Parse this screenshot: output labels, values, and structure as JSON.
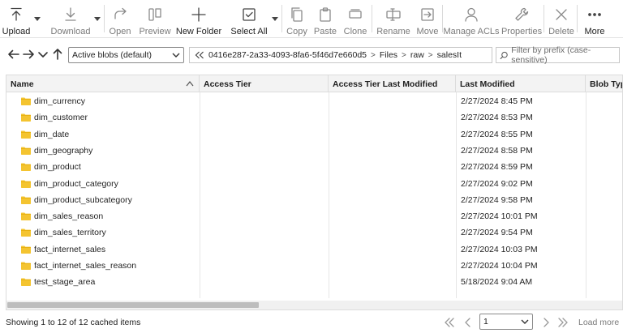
{
  "toolbar": {
    "upload": "Upload",
    "download": "Download",
    "open": "Open",
    "preview": "Preview",
    "new_folder": "New Folder",
    "select_all": "Select All",
    "copy": "Copy",
    "paste": "Paste",
    "clone": "Clone",
    "rename": "Rename",
    "move": "Move",
    "manage_acls": "Manage ACLs",
    "properties": "Properties",
    "delete": "Delete",
    "more": "More"
  },
  "nav": {
    "blob_filter": "Active blobs (default)",
    "breadcrumb": [
      "0416e287-2a33-4093-8fa6-5f46d7e660d5",
      "Files",
      "raw",
      "salesIt"
    ],
    "filter_placeholder": "Filter by prefix (case-sensitive)"
  },
  "grid": {
    "columns": [
      "Name",
      "Access Tier",
      "Access Tier Last Modified",
      "Last Modified",
      "Blob Type"
    ],
    "rows": [
      {
        "name": "dim_currency",
        "modified": "2/27/2024 8:45 PM"
      },
      {
        "name": "dim_customer",
        "modified": "2/27/2024 8:53 PM"
      },
      {
        "name": "dim_date",
        "modified": "2/27/2024 8:55 PM"
      },
      {
        "name": "dim_geography",
        "modified": "2/27/2024 8:58 PM"
      },
      {
        "name": "dim_product",
        "modified": "2/27/2024 8:59 PM"
      },
      {
        "name": "dim_product_category",
        "modified": "2/27/2024 9:02 PM"
      },
      {
        "name": "dim_product_subcategory",
        "modified": "2/27/2024 9:58 PM"
      },
      {
        "name": "dim_sales_reason",
        "modified": "2/27/2024 10:01 PM"
      },
      {
        "name": "dim_sales_territory",
        "modified": "2/27/2024 9:54 PM"
      },
      {
        "name": "fact_internet_sales",
        "modified": "2/27/2024 10:03 PM"
      },
      {
        "name": "fact_internet_sales_reason",
        "modified": "2/27/2024 10:04 PM"
      },
      {
        "name": "test_stage_area",
        "modified": "5/18/2024 9:04 AM"
      }
    ]
  },
  "status": {
    "text": "Showing 1 to 12 of 12 cached items",
    "page": "1",
    "load_more": "Load more"
  },
  "colors": {
    "folder": "#f4c430",
    "folder_tab": "#e0a800"
  }
}
